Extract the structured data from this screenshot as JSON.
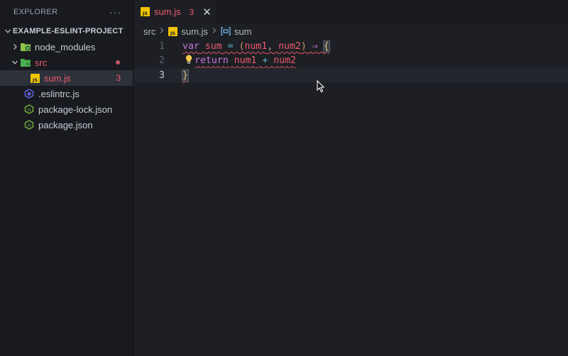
{
  "sidebar": {
    "title": "EXPLORER",
    "more": "···",
    "project": "EXAMPLE-ESLINT-PROJECT",
    "items": [
      {
        "label": "node_modules"
      },
      {
        "label": "src"
      },
      {
        "label": "sum.js",
        "count": "3"
      },
      {
        "label": ".eslintrc.js"
      },
      {
        "label": "package-lock.json"
      },
      {
        "label": "package.json"
      }
    ]
  },
  "tab": {
    "label": "sum.js",
    "count": "3",
    "close": "✕"
  },
  "breadcrumb": {
    "folder": "src",
    "file": "sum.js",
    "symbol": "sum"
  },
  "editor": {
    "line_numbers": [
      "1",
      "2",
      "3"
    ],
    "line1": {
      "kw": "var",
      "name": "sum",
      "eq": "=",
      "open": "(",
      "p1": "num1",
      "comma": ",",
      "p2": "num2",
      "close": ")",
      "arrow": "⇒",
      "brace": "{"
    },
    "line2": {
      "kw": "return",
      "a": "num1",
      "plus": "+",
      "b": "num2"
    },
    "line3": {
      "brace": "}"
    }
  },
  "colors": {
    "error": "#ef596f",
    "keyword": "#c678dd",
    "operator": "#56b6c2",
    "js_icon": "#f0c400"
  }
}
